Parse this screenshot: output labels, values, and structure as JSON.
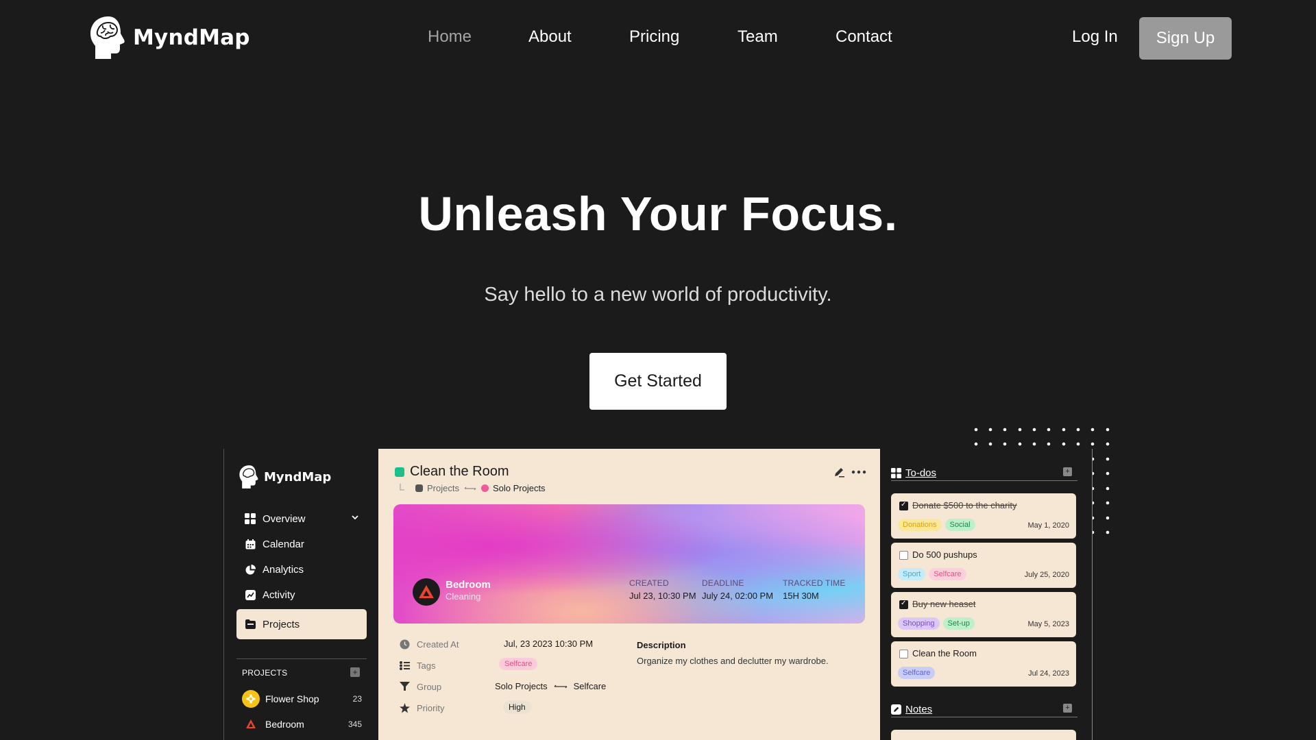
{
  "brand": {
    "name": "MyndMap"
  },
  "nav": {
    "links": [
      {
        "label": "Home",
        "active": true
      },
      {
        "label": "About"
      },
      {
        "label": "Pricing"
      },
      {
        "label": "Team"
      },
      {
        "label": "Contact"
      }
    ],
    "login_label": "Log In",
    "signup_label": "Sign Up"
  },
  "hero": {
    "title": "Unleash Your Focus.",
    "subtitle": "Say hello to a new world of productivity.",
    "cta_label": "Get Started"
  },
  "app": {
    "brand_name": "MyndMap",
    "sidebar": {
      "items": [
        {
          "label": "Overview",
          "icon": "grid-icon"
        },
        {
          "label": "Calendar",
          "icon": "calendar-icon"
        },
        {
          "label": "Analytics",
          "icon": "pie-chart-icon"
        },
        {
          "label": "Activity",
          "icon": "activity-icon"
        },
        {
          "label": "Projects",
          "icon": "folder-icon",
          "active": true
        }
      ],
      "projects_heading": "PROJECTS",
      "projects": [
        {
          "name": "Flower Shop",
          "count": "23",
          "color": "#f6c417"
        },
        {
          "name": "Bedroom",
          "count": "345",
          "color": "#1b1b1b"
        }
      ]
    },
    "task": {
      "title": "Clean the Room",
      "breadcrumb_1": "Projects",
      "breadcrumb_2": "Solo Projects",
      "banner": {
        "project_name": "Bedroom",
        "project_category": "Cleaning",
        "created_label": "CREATED",
        "created_value": "Jul 23, 10:30 PM",
        "deadline_label": "DEADLINE",
        "deadline_value": "July 24, 02:00 PM",
        "tracked_label": "TRACKED TIME",
        "tracked_value": "15H 30M"
      },
      "fields": {
        "created_at_label": "Created At",
        "created_at_value": "Jul, 23 2023 10:30 PM",
        "tags_label": "Tags",
        "tag_value": "Selfcare",
        "group_label": "Group",
        "group_from": "Solo Projects",
        "group_to": "Selfcare",
        "priority_label": "Priority",
        "priority_value": "High"
      },
      "description_heading": "Description",
      "description_text": "Organize my clothes and declutter my wardrobe."
    },
    "todos": {
      "heading": "To-dos",
      "items": [
        {
          "title": "Donate $500 to the charity",
          "done": true,
          "date": "May 1, 2020",
          "tags": [
            {
              "label": "Donations",
              "bg": "#fbe79a",
              "fg": "#e2a100"
            },
            {
              "label": "Social",
              "bg": "#bdf0c9",
              "fg": "#18884a"
            }
          ]
        },
        {
          "title": "Do 500 pushups",
          "done": false,
          "date": "July 25, 2020",
          "tags": [
            {
              "label": "Sport",
              "bg": "#c5ecf8",
              "fg": "#3aaed8"
            },
            {
              "label": "Selfcare",
              "bg": "#fbd0dc",
              "fg": "#e4507d"
            }
          ]
        },
        {
          "title": "Buy new heaset",
          "done": true,
          "date": "May 5, 2023",
          "tags": [
            {
              "label": "Shopping",
              "bg": "#dcc8f6",
              "fg": "#7b4ad0"
            },
            {
              "label": "Set-up",
              "bg": "#bdf0c9",
              "fg": "#18884a"
            }
          ]
        },
        {
          "title": "Clean the Room",
          "done": false,
          "date": "Jul 24, 2023",
          "tags": [
            {
              "label": "Selfcare",
              "bg": "#c9cdf6",
              "fg": "#5a62d8"
            }
          ]
        }
      ]
    },
    "notes": {
      "heading": "Notes"
    }
  }
}
